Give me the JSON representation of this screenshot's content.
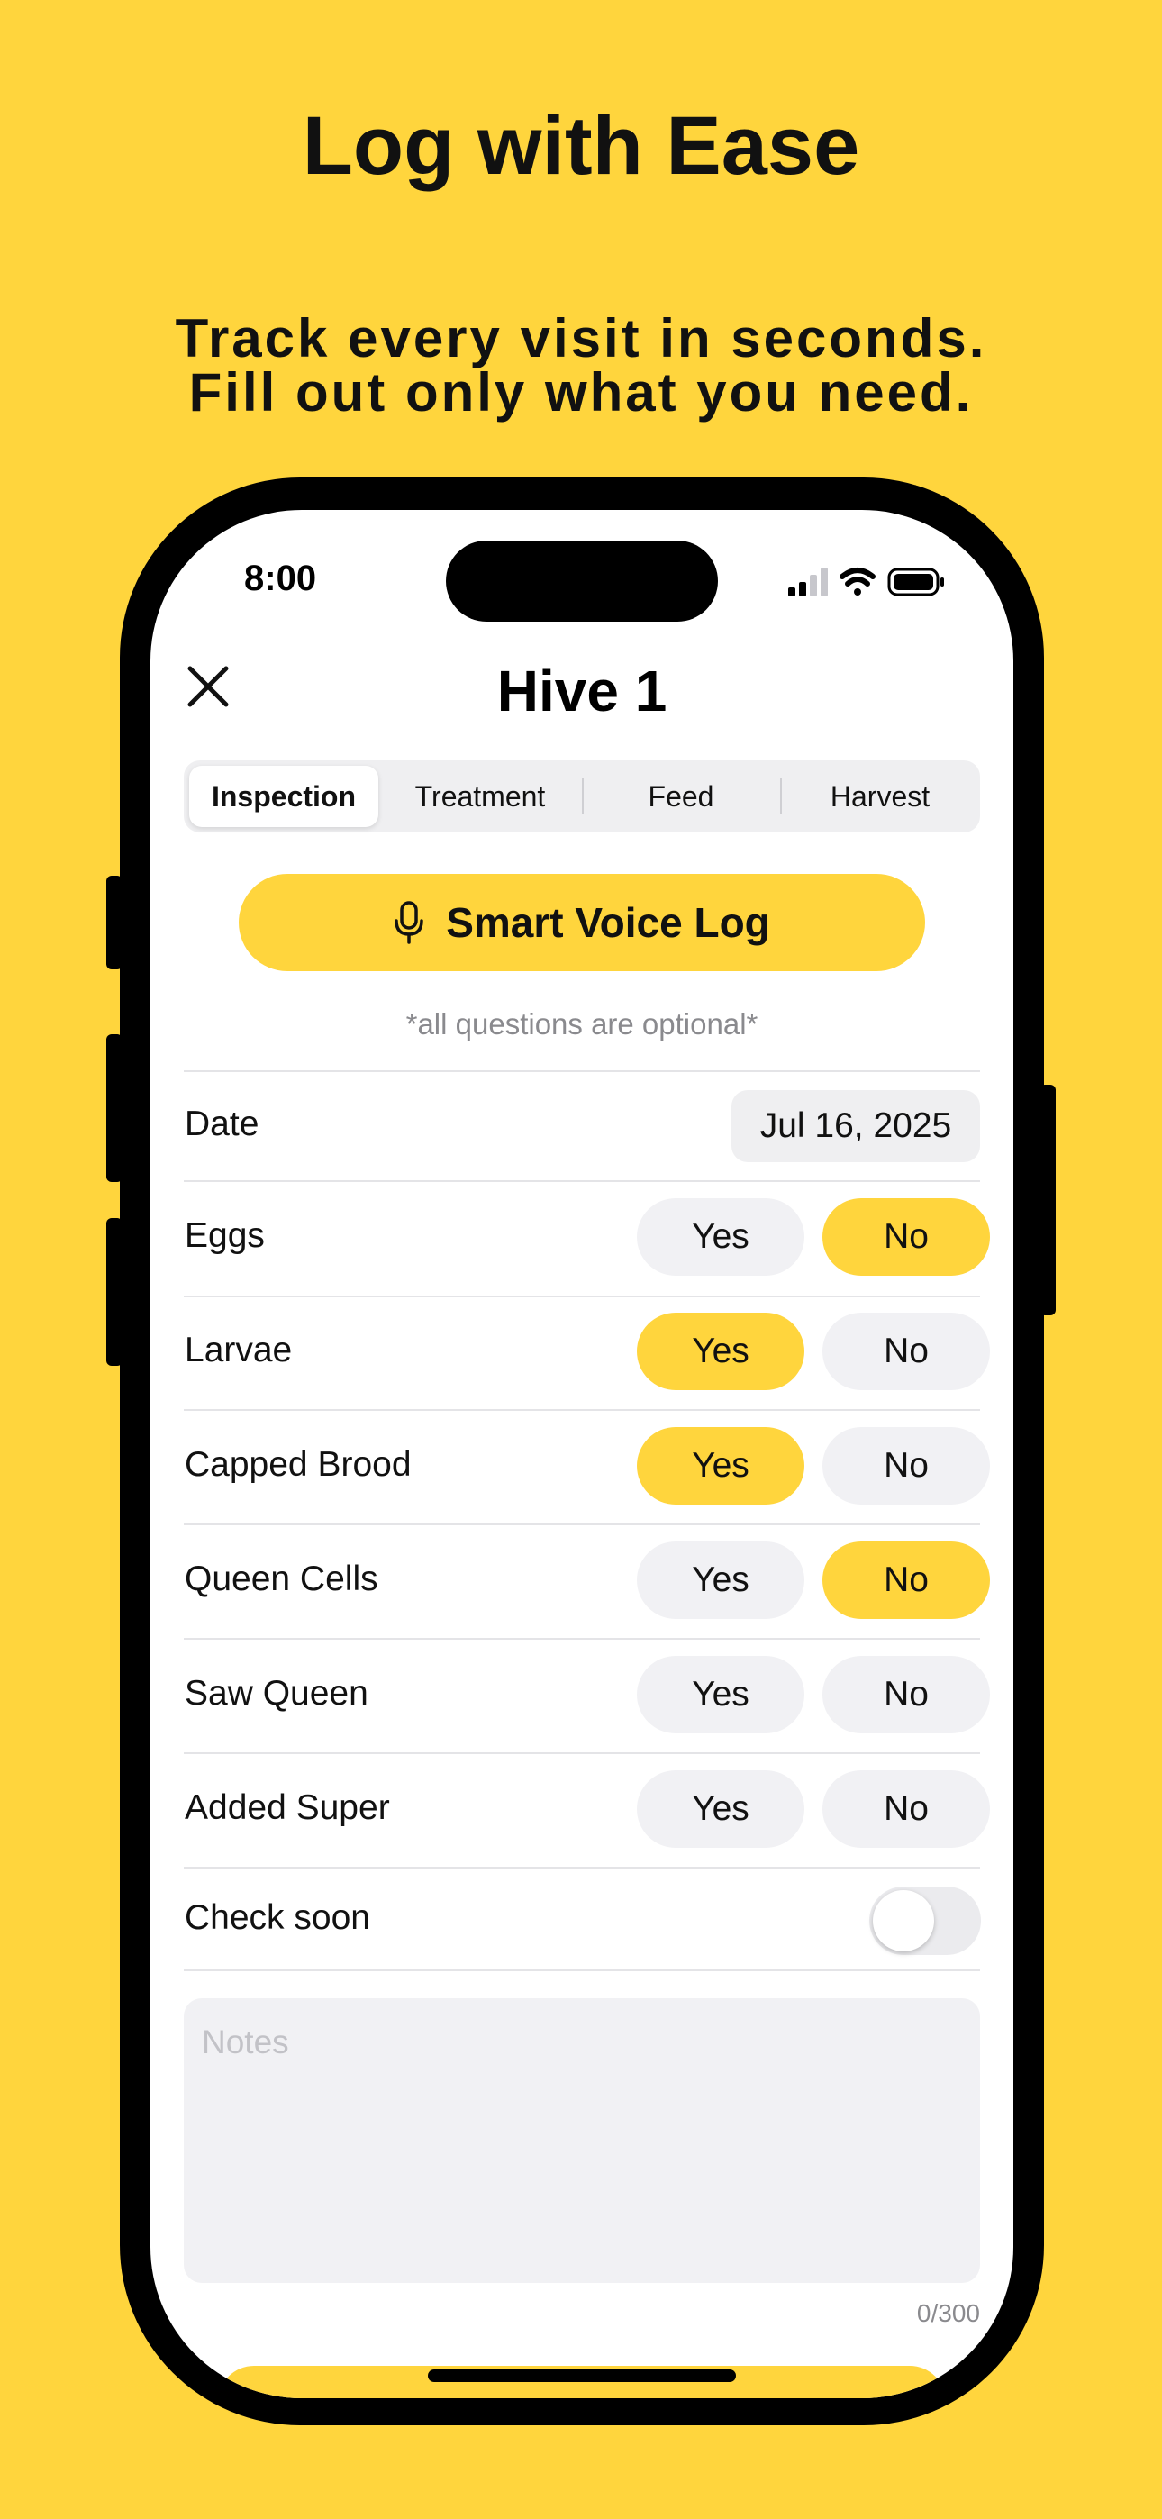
{
  "marketing": {
    "headline": "Log with Ease",
    "subline_1": "Track every visit in seconds.",
    "subline_2": "Fill out only what you need."
  },
  "status_bar": {
    "time": "8:00",
    "icons": [
      "cellular-signal-icon",
      "wifi-icon",
      "battery-icon"
    ]
  },
  "header": {
    "title": "Hive 1",
    "close_icon": "close-icon"
  },
  "tabs": [
    {
      "label": "Inspection",
      "active": true
    },
    {
      "label": "Treatment",
      "active": false
    },
    {
      "label": "Feed",
      "active": false
    },
    {
      "label": "Harvest",
      "active": false
    }
  ],
  "voice_button": {
    "label": "Smart Voice Log",
    "icon": "microphone-icon"
  },
  "optional_note": "*all questions are optional*",
  "date_row": {
    "label": "Date",
    "value": "Jul 16, 2025"
  },
  "yes_label": "Yes",
  "no_label": "No",
  "questions": [
    {
      "label": "Eggs",
      "selected": "No"
    },
    {
      "label": "Larvae",
      "selected": "Yes"
    },
    {
      "label": "Capped Brood",
      "selected": "Yes"
    },
    {
      "label": "Queen Cells",
      "selected": "No"
    },
    {
      "label": "Saw Queen",
      "selected": null
    },
    {
      "label": "Added Super",
      "selected": null
    }
  ],
  "check_soon": {
    "label": "Check soon",
    "on": false
  },
  "notes": {
    "placeholder": "Notes",
    "value": "",
    "counter": "0/300"
  },
  "colors": {
    "accent": "#FFD53D",
    "pill_inactive": "#F1F1F4",
    "text": "#111111",
    "muted": "#8A8A8E"
  }
}
